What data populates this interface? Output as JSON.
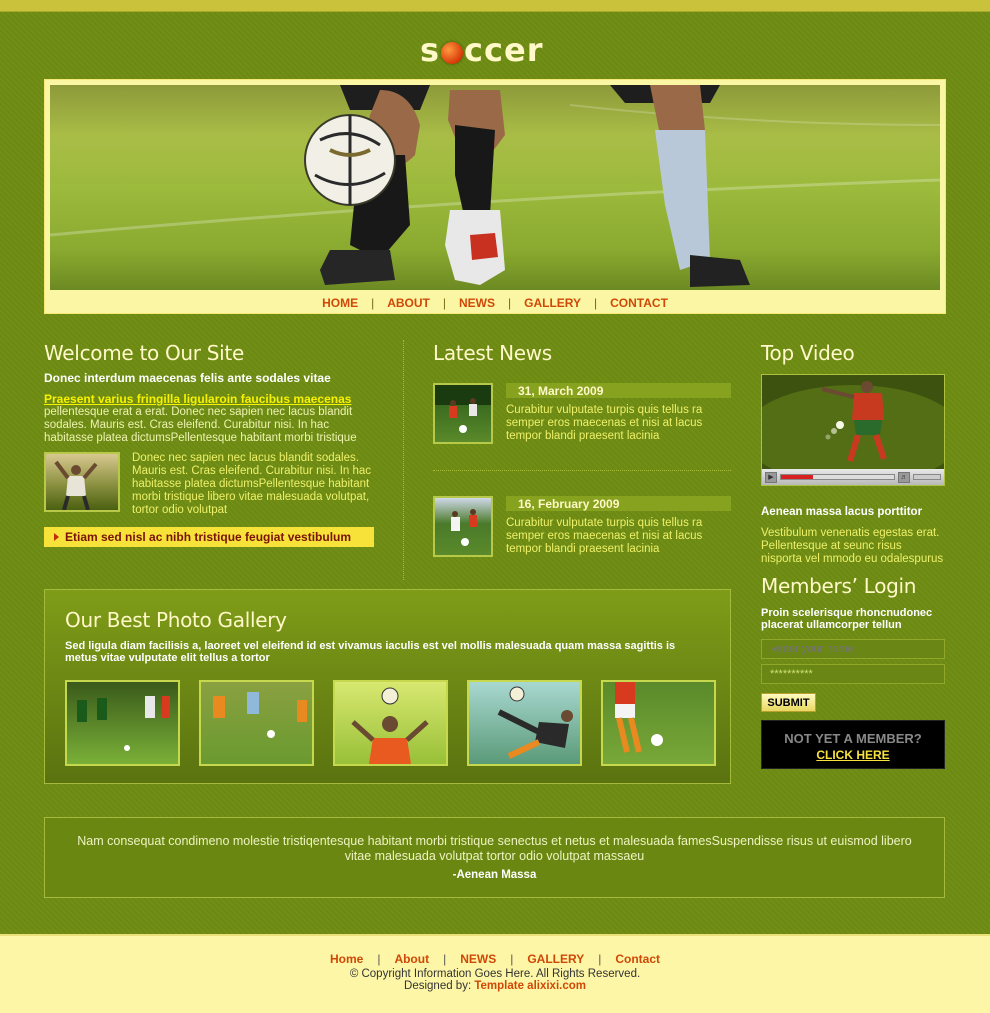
{
  "logo": {
    "pre": "s",
    "post": "ccer"
  },
  "nav": {
    "items": [
      "HOME",
      "ABOUT",
      "NEWS",
      "GALLERY",
      "CONTACT"
    ]
  },
  "welcome": {
    "title": "Welcome to Our Site",
    "lead": "Donec interdum maecenas felis ante sodales vitae",
    "link": "Praesent varius fringilla ligularoin faucibus maecenas",
    "para1": "pellentesque erat a erat. Donec nec sapien nec lacus blandit sodales. Mauris est. Cras eleifend. Curabitur nisi. In hac habitasse platea dictumsPellentesque habitant morbi tristique",
    "para2": "Donec nec sapien nec lacus blandit sodales. Mauris est. Cras eleifend. Curabitur nisi. In hac habitasse platea dictumsPellentesque habitant morbi tristique libero vitae malesuada volutpat, tortor odio volutpat",
    "bar": "Etiam sed nisl ac nibh tristique feugiat vestibulum"
  },
  "news": {
    "title": "Latest News",
    "items": [
      {
        "date": "31, March 2009",
        "text": "Curabitur vulputate turpis quis tellus ra semper eros maecenas et nisi at lacus tempor blandi praesent lacinia"
      },
      {
        "date": "16, February 2009",
        "text": "Curabitur vulputate turpis quis tellus ra semper eros maecenas et nisi at lacus tempor blandi praesent lacinia"
      }
    ]
  },
  "video": {
    "title": "Top Video",
    "progress": 0.28,
    "caption": "Aenean massa lacus porttitor",
    "text": "Vestibulum venenatis egestas erat. Pellentesque at seunc risus nisporta vel mmodo eu odalespurus"
  },
  "login": {
    "title": "Members’ Login",
    "text": "Proin scelerisque rhoncnudonec placerat ullamcorper tellun",
    "name_placeholder": "-enter your name",
    "password_value": "**********",
    "submit": "SUBMIT",
    "member_q": "NOT YET A MEMBER?",
    "member_link": "CLICK HERE"
  },
  "gallery": {
    "title": "Our Best Photo Gallery",
    "sub": "Sed ligula diam facilisis a, laoreet vel eleifend id est vivamus iaculis est vel mollis malesuada quam massa sagittis is metus vitae vulputate elit tellus a tortor"
  },
  "quote": {
    "text": "Nam consequat condimeno molestie tristiqentesque habitant morbi tristique senectus et netus et malesuada famesSuspendisse risus ut euismod libero vitae malesuada volutpat tortor odio volutpat massaeu",
    "author": "-Aenean Massa"
  },
  "footer": {
    "nav": [
      "Home",
      "About",
      "NEWS",
      "GALLERY",
      "Contact"
    ],
    "copyright": "© Copyright Information Goes Here. All Rights Reserved.",
    "designed_label": "Designed by:",
    "designed_link": "Template alixixi.com"
  },
  "colors": {
    "background": "#6e8c12",
    "accent": "#d04808",
    "banner_frame": "#fbf6a4",
    "highlight": "#f8f200"
  }
}
